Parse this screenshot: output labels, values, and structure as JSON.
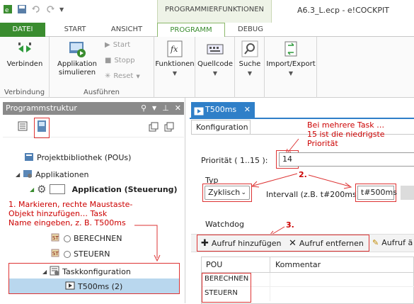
{
  "window": {
    "title": "A6.3_L.ecp - e!COCKPIT",
    "context_tab": "PROGRAMMIERFUNKTIONEN"
  },
  "tabs": [
    {
      "label": "DATEI"
    },
    {
      "label": "START"
    },
    {
      "label": "ANSICHT"
    },
    {
      "label": "PROGRAMM"
    },
    {
      "label": "DEBUG"
    }
  ],
  "ribbon": {
    "verbinden": "Verbinden",
    "group_verbindung": "Verbindung",
    "applikation": "Applikation",
    "simulieren": "simulieren",
    "start": "Start",
    "stopp": "Stopp",
    "reset": "Reset",
    "group_ausfuehren": "Ausführen",
    "funktionen": "Funktionen",
    "quellcode": "Quellcode",
    "suche": "Suche",
    "import_export": "Import/Export"
  },
  "left_panel": {
    "title": "Programmstruktur",
    "projektbibliothek": "Projektbibliothek (POUs)",
    "applikationen": "Applikationen",
    "application": "Application (Steuerung)",
    "note_1_line1": "1. Markieren, rechte Maustaste-",
    "note_1_line2": "Objekt hinzufügen… Task",
    "note_1_line3": "Name eingeben, z. B. T500ms",
    "berechnen": "BERECHNEN",
    "steuern": "STEUERN",
    "taskkonfiguration": "Taskkonfiguration",
    "task": "T500ms (2)"
  },
  "editor": {
    "doc_tab": "T500ms",
    "konfiguration_tab": "Konfiguration",
    "note_top_line1": "Bei mehrere Task …",
    "note_top_line2": "15 ist die niedrigste Priorität",
    "prioritaet_label": "Priorität ( 1..15 ):",
    "prioritaet_value": "14",
    "typ_label": "Typ",
    "note_2": "2.",
    "typ_value": "Zyklisch",
    "intervall_label": "Intervall (z.B. t#200ms):",
    "intervall_value": "t#500ms",
    "watchdog_label": "Watchdog",
    "note_3": "3.",
    "aufruf_hinzufuegen": "Aufruf hinzufügen",
    "aufruf_entfernen": "Aufruf entfernen",
    "aufruf_cut": "Aufruf ä",
    "col_pou": "POU",
    "col_kommentar": "Kommentar",
    "rows": [
      {
        "pou": "BERECHNEN",
        "kommentar": ""
      },
      {
        "pou": "STEUERN",
        "kommentar": ""
      }
    ]
  },
  "colors": {
    "accent_green": "#3a8c2f",
    "doc_blue": "#2f7fc8",
    "annotation_red": "#cc0000",
    "selection": "#b9d7ee"
  }
}
